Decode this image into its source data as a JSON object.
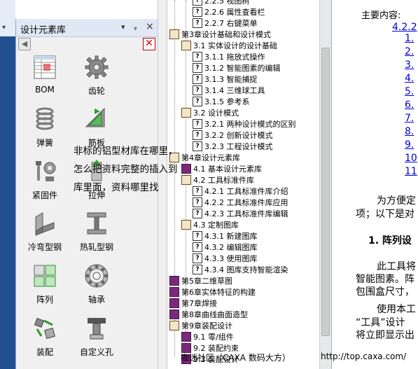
{
  "library_panel": {
    "title": "设计元素库",
    "pin_glyph": "▾",
    "dock_glyph": "ᵩ",
    "close_glyph": "×",
    "back_glyph": "◀",
    "delete_glyph": "✕",
    "items": [
      {
        "label": "BOM",
        "icon": "bom-table-icon"
      },
      {
        "label": "齿轮",
        "icon": "gear-icon"
      },
      {
        "label": "弹簧",
        "icon": "spring-icon"
      },
      {
        "label": "筋板",
        "icon": "rib-plate-icon"
      },
      {
        "label": "紧固件",
        "icon": "fastener-icon"
      },
      {
        "label": "拉伸",
        "icon": "extrude-icon"
      },
      {
        "label": "冷弯型钢",
        "icon": "cold-formed-steel-icon"
      },
      {
        "label": "热轧型钢",
        "icon": "hot-rolled-steel-icon"
      },
      {
        "label": "阵列",
        "icon": "array-icon"
      },
      {
        "label": "轴承",
        "icon": "bearing-icon"
      },
      {
        "label": "装配",
        "icon": "assembly-icon"
      },
      {
        "label": "自定义孔",
        "icon": "custom-hole-icon"
      }
    ]
  },
  "question": "非标的铝型材库在哪里，怎么把资料完整的插入到库里面，资料哪里找",
  "tree": [
    {
      "text": "2.2.5 视图树",
      "icon": "q"
    },
    {
      "text": "2.2.6 属性查看栏",
      "icon": "q"
    },
    {
      "text": "2.2.7 右键菜单",
      "icon": "q"
    },
    {
      "text": "第3章设计基础和设计模式",
      "icon": "book-open"
    },
    {
      "text": "3.1 实体设计的设计基础",
      "icon": "book-open"
    },
    {
      "text": "3.1.1 拖放式操作",
      "icon": "q"
    },
    {
      "text": "3.1.2 智能图素的编辑",
      "icon": "q"
    },
    {
      "text": "3.1.3 智能捕捉",
      "icon": "q"
    },
    {
      "text": "3.1.4 三维球工具",
      "icon": "q"
    },
    {
      "text": "3.1.5 参考系",
      "icon": "q"
    },
    {
      "text": "3.2 设计模式",
      "icon": "book-open"
    },
    {
      "text": "3.2.1 两种设计模式的区别",
      "icon": "q"
    },
    {
      "text": "3.2.2 创新设计模式",
      "icon": "q"
    },
    {
      "text": "3.2.3 工程设计模式",
      "icon": "q"
    },
    {
      "text": "第4章设计元素库",
      "icon": "book-open"
    },
    {
      "text": "4.1 基本设计元素库",
      "icon": "book-closed"
    },
    {
      "text": "4.2 工具标准件库",
      "icon": "book-open"
    },
    {
      "text": "4.2.1 工具标准件库介绍",
      "icon": "q"
    },
    {
      "text": "4.2.2 工具标准件库应用",
      "icon": "q"
    },
    {
      "text": "4.2.3 工具标准件库编辑",
      "icon": "q"
    },
    {
      "text": "4.3 定制图库",
      "icon": "book-open"
    },
    {
      "text": "4.3.1 新建图库",
      "icon": "q"
    },
    {
      "text": "4.3.2 编辑图库",
      "icon": "q"
    },
    {
      "text": "4.3.3 使用图库",
      "icon": "q"
    },
    {
      "text": "4.3.4 图库支持智能渲染",
      "icon": "q"
    },
    {
      "text": "第5章二维草图",
      "icon": "book-closed"
    },
    {
      "text": "第6章实体特征的构建",
      "icon": "book-closed"
    },
    {
      "text": "第7章焊接",
      "icon": "book-closed"
    },
    {
      "text": "第8章曲线曲面造型",
      "icon": "book-closed"
    },
    {
      "text": "第9章装配设计",
      "icon": "book-open"
    },
    {
      "text": "9.1 零/组件",
      "icon": "book-closed"
    },
    {
      "text": "9.2 装配约束",
      "icon": "book-closed"
    },
    {
      "text": "9.3 装配设计",
      "icon": "book-closed"
    }
  ],
  "doc": {
    "heading": "主要内容:",
    "main_link": "4.2.2",
    "numbers": [
      "1.",
      "2.",
      "3.",
      "4.",
      "5.",
      "6.",
      "7.",
      "8.",
      "9.",
      "10",
      "11"
    ],
    "para1_line1": "为方便定",
    "para1_line2": "项；以下是对",
    "section_title": "1. 阵列设",
    "para2_line1": "此工具将",
    "para2_line2": "智能图素。阵",
    "para2_line3": "包围盒尺寸，",
    "para3_line1": "使用本工",
    "para3_line2": "“工具”设计",
    "para3_line3": "将立即显示出"
  },
  "status": {
    "left": "咖迷社区（CAXA 数码大方）",
    "url": "http://top.caxa.com/"
  },
  "colors": {
    "accent_blue": "#1f4f8f",
    "link": "#0000cc",
    "book_closed": "#7a2a7a",
    "delete_red": "#d00000"
  }
}
